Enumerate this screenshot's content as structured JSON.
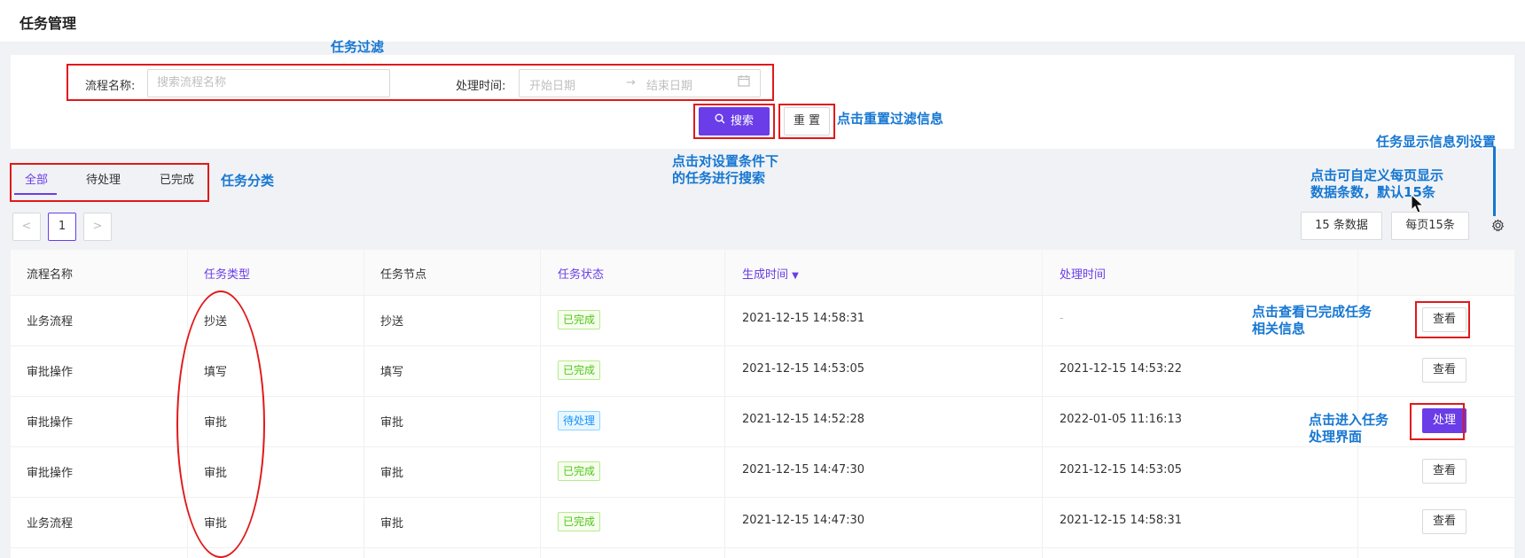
{
  "header": {
    "title": "任务管理"
  },
  "filter": {
    "process_label": "流程名称:",
    "process_placeholder": "搜索流程名称",
    "time_label": "处理时间:",
    "start_placeholder": "开始日期",
    "end_placeholder": "结束日期",
    "search_label": "搜索",
    "reset_label": "重 置"
  },
  "tabs": [
    {
      "label": "全部",
      "active": true
    },
    {
      "label": "待处理",
      "active": false
    },
    {
      "label": "已完成",
      "active": false
    }
  ],
  "pagination": {
    "prev": "<",
    "current": "1",
    "next": ">"
  },
  "toolbar": {
    "count_label": "15 条数据",
    "page_size_label": "每页15条"
  },
  "table": {
    "columns": [
      "流程名称",
      "任务类型",
      "任务节点",
      "任务状态",
      "生成时间",
      "处理时间"
    ],
    "sort_indicator": "▼",
    "rows": [
      {
        "process": "业务流程",
        "type": "抄送",
        "node": "抄送",
        "status": "已完成",
        "created": "2021-12-15 14:58:31",
        "handled": "-",
        "action": "查看"
      },
      {
        "process": "审批操作",
        "type": "填写",
        "node": "填写",
        "status": "已完成",
        "created": "2021-12-15 14:53:05",
        "handled": "2021-12-15 14:53:22",
        "action": "查看"
      },
      {
        "process": "审批操作",
        "type": "审批",
        "node": "审批",
        "status": "待处理",
        "created": "2021-12-15 14:52:28",
        "handled": "2022-01-05 11:16:13",
        "action": "处理"
      },
      {
        "process": "审批操作",
        "type": "审批",
        "node": "审批",
        "status": "已完成",
        "created": "2021-12-15 14:47:30",
        "handled": "2021-12-15 14:53:05",
        "action": "查看"
      },
      {
        "process": "业务流程",
        "type": "审批",
        "node": "审批",
        "status": "已完成",
        "created": "2021-12-15 14:47:30",
        "handled": "2021-12-15 14:58:31",
        "action": "查看"
      }
    ]
  },
  "annotations": {
    "filter": "任务过滤",
    "reset": "点击重置过滤信息",
    "search_line1": "点击对设置条件下",
    "search_line2": "的任务进行搜索",
    "category": "任务分类",
    "column_settings": "任务显示信息列设置",
    "page_size_line1": "点击可自定义每页显示",
    "page_size_line2": "数据条数，默认15条",
    "view_line1": "点击查看已完成任务",
    "view_line2": "相关信息",
    "handle_line1": "点击进入任务",
    "handle_line2": "处理界面"
  },
  "colors": {
    "primary": "#6a3de8",
    "annotation_blue": "#1677d2",
    "annotation_red": "#e0191a"
  }
}
